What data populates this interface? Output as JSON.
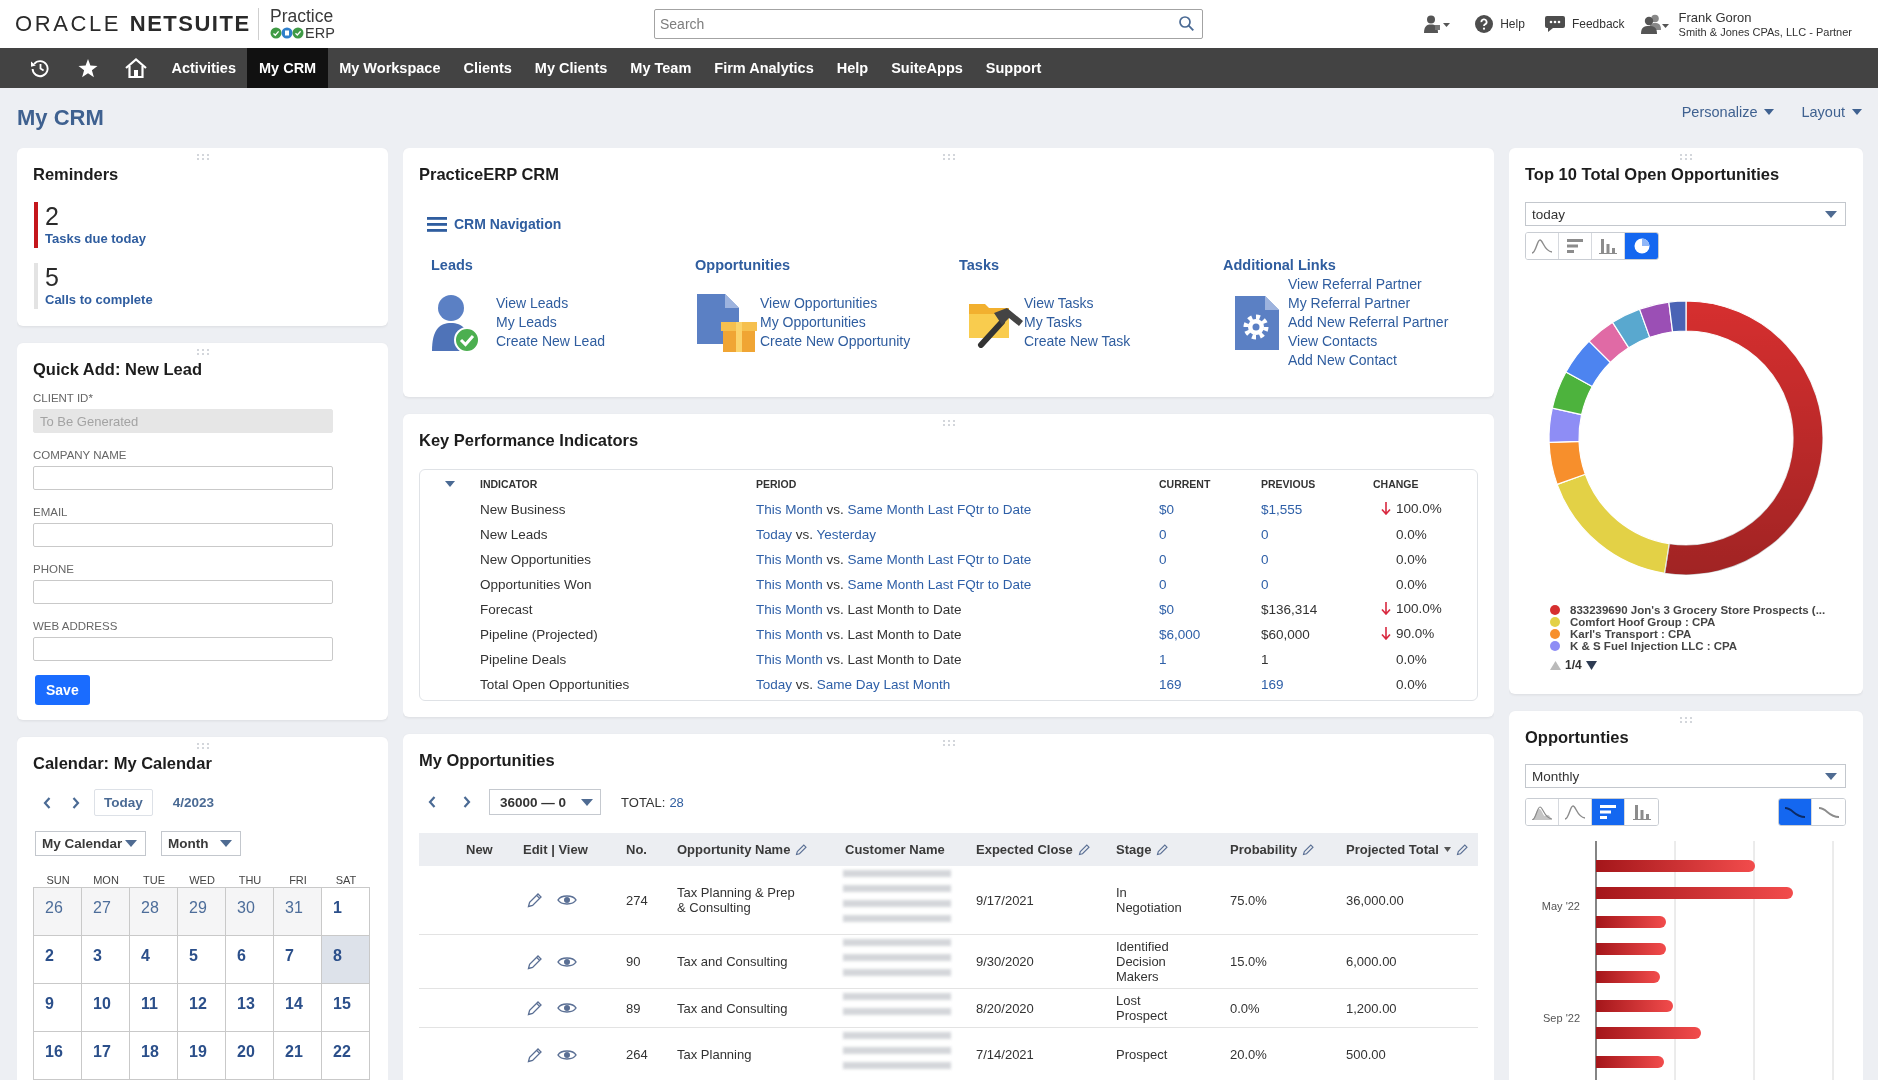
{
  "header": {
    "brand": {
      "primary": "ORACLE",
      "secondary": "NETSUITE"
    },
    "partner_logo": {
      "top": "Practice",
      "bottom": "ERP"
    },
    "search": {
      "placeholder": "Search"
    },
    "links": [
      {
        "label": "Help",
        "kind": "help"
      },
      {
        "label": "Feedback",
        "kind": "feedback"
      }
    ],
    "user": {
      "name": "Frank Goron",
      "role": "Smith & Jones CPAs, LLC - Partner"
    }
  },
  "nav": {
    "items": [
      {
        "label": "Activities",
        "selected": false
      },
      {
        "label": "My CRM",
        "selected": true
      },
      {
        "label": "My Workspace",
        "selected": false
      },
      {
        "label": "Clients",
        "selected": false
      },
      {
        "label": "My Clients",
        "selected": false
      },
      {
        "label": "My Team",
        "selected": false
      },
      {
        "label": "Firm Analytics",
        "selected": false
      },
      {
        "label": "Help",
        "selected": false
      },
      {
        "label": "SuiteApps",
        "selected": false
      },
      {
        "label": "Support",
        "selected": false
      }
    ]
  },
  "page": {
    "title": "My CRM",
    "actions": [
      "Personalize",
      "Layout"
    ]
  },
  "reminders": {
    "title": "Reminders",
    "items": [
      {
        "count": "2",
        "label": "Tasks due today",
        "urgent": true
      },
      {
        "count": "5",
        "label": "Calls to complete",
        "urgent": false
      }
    ]
  },
  "quick_add": {
    "title": "Quick Add: New Lead",
    "fields": [
      {
        "label": "CLIENT ID*",
        "value": "To Be Generated",
        "disabled": true
      },
      {
        "label": "COMPANY NAME",
        "disabled": false
      },
      {
        "label": "EMAIL",
        "disabled": false
      },
      {
        "label": "PHONE",
        "disabled": false
      },
      {
        "label": "WEB ADDRESS",
        "disabled": false
      }
    ],
    "button": "Save"
  },
  "calendar": {
    "title": "Calendar: My Calendar",
    "today_button": "Today",
    "period": "4/2023",
    "selects": [
      "My Calendar",
      "Month"
    ],
    "weekdays": [
      "SUN",
      "MON",
      "TUE",
      "WED",
      "THU",
      "FRI",
      "SAT"
    ],
    "weeks": [
      [
        {
          "day": "26",
          "in_month": false,
          "today": false
        },
        {
          "day": "27",
          "in_month": false,
          "today": false
        },
        {
          "day": "28",
          "in_month": false,
          "today": false
        },
        {
          "day": "29",
          "in_month": false,
          "today": false
        },
        {
          "day": "30",
          "in_month": false,
          "today": false
        },
        {
          "day": "31",
          "in_month": false,
          "today": false
        },
        {
          "day": "1",
          "in_month": true,
          "today": false
        }
      ],
      [
        {
          "day": "2",
          "in_month": true,
          "today": false
        },
        {
          "day": "3",
          "in_month": true,
          "today": false
        },
        {
          "day": "4",
          "in_month": true,
          "today": false
        },
        {
          "day": "5",
          "in_month": true,
          "today": false
        },
        {
          "day": "6",
          "in_month": true,
          "today": false
        },
        {
          "day": "7",
          "in_month": true,
          "today": false
        },
        {
          "day": "8",
          "in_month": true,
          "today": true
        }
      ],
      [
        {
          "day": "9",
          "in_month": true,
          "today": false
        },
        {
          "day": "10",
          "in_month": true,
          "today": false
        },
        {
          "day": "11",
          "in_month": true,
          "today": false
        },
        {
          "day": "12",
          "in_month": true,
          "today": false
        },
        {
          "day": "13",
          "in_month": true,
          "today": false
        },
        {
          "day": "14",
          "in_month": true,
          "today": false
        },
        {
          "day": "15",
          "in_month": true,
          "today": false
        }
      ],
      [
        {
          "day": "16",
          "in_month": true,
          "today": false
        },
        {
          "day": "17",
          "in_month": true,
          "today": false
        },
        {
          "day": "18",
          "in_month": true,
          "today": false
        },
        {
          "day": "19",
          "in_month": true,
          "today": false
        },
        {
          "day": "20",
          "in_month": true,
          "today": false
        },
        {
          "day": "21",
          "in_month": true,
          "today": false
        },
        {
          "day": "22",
          "in_month": true,
          "today": false
        }
      ]
    ]
  },
  "crm": {
    "title": "PracticeERP CRM",
    "nav_link": "CRM Navigation",
    "sections": [
      {
        "kind": "leads",
        "title": "Leads",
        "links": [
          "View Leads",
          "My Leads",
          "Create New Lead"
        ]
      },
      {
        "kind": "opportunities",
        "title": "Opportunities",
        "links": [
          "View Opportunities",
          "My Opportunities",
          "Create New Opportunity"
        ]
      },
      {
        "kind": "tasks",
        "title": "Tasks",
        "links": [
          "View Tasks",
          "My Tasks",
          "Create New Task"
        ]
      },
      {
        "kind": "additional",
        "title": "Additional Links",
        "links": [
          "View Referral Partner",
          "My Referral Partner",
          "Add New Referral Partner",
          "View Contacts",
          "Add New Contact"
        ]
      }
    ]
  },
  "kpi": {
    "title": "Key Performance Indicators",
    "expanded": true,
    "columns": [
      "INDICATOR",
      "PERIOD",
      "CURRENT",
      "PREVIOUS",
      "CHANGE"
    ],
    "rows": [
      {
        "indicator": "New Business",
        "period": {
          "current": "This Month",
          "vs": "vs.",
          "compare": "Same Month Last FQtr to Date",
          "compare_link": true
        },
        "current": {
          "text": "$0",
          "link": true
        },
        "previous": {
          "text": "$1,555",
          "link": true
        },
        "change": {
          "text": "100.0%",
          "down": true
        }
      },
      {
        "indicator": "New Leads",
        "period": {
          "current": "Today",
          "vs": "vs.",
          "compare": "Yesterday",
          "compare_link": true
        },
        "current": {
          "text": "0",
          "link": true
        },
        "previous": {
          "text": "0",
          "link": true
        },
        "change": {
          "text": "0.0%",
          "down": false
        }
      },
      {
        "indicator": "New Opportunities",
        "period": {
          "current": "This Month",
          "vs": "vs.",
          "compare": "Same Month Last FQtr to Date",
          "compare_link": true
        },
        "current": {
          "text": "0",
          "link": true
        },
        "previous": {
          "text": "0",
          "link": true
        },
        "change": {
          "text": "0.0%",
          "down": false
        }
      },
      {
        "indicator": "Opportunities Won",
        "period": {
          "current": "This Month",
          "vs": "vs.",
          "compare": "Same Month Last FQtr to Date",
          "compare_link": true
        },
        "current": {
          "text": "0",
          "link": true
        },
        "previous": {
          "text": "0",
          "link": true
        },
        "change": {
          "text": "0.0%",
          "down": false
        }
      },
      {
        "indicator": "Forecast",
        "period": {
          "current": "This Month",
          "vs": "vs.",
          "compare": "Last Month to Date",
          "compare_link": false
        },
        "current": {
          "text": "$0",
          "link": true
        },
        "previous": {
          "text": "$136,314",
          "link": false
        },
        "change": {
          "text": "100.0%",
          "down": true
        }
      },
      {
        "indicator": "Pipeline (Projected)",
        "period": {
          "current": "This Month",
          "vs": "vs.",
          "compare": "Last Month to Date",
          "compare_link": false
        },
        "current": {
          "text": "$6,000",
          "link": true
        },
        "previous": {
          "text": "$60,000",
          "link": false
        },
        "change": {
          "text": "90.0%",
          "down": true
        }
      },
      {
        "indicator": "Pipeline Deals",
        "period": {
          "current": "This Month",
          "vs": "vs.",
          "compare": "Last Month to Date",
          "compare_link": false
        },
        "current": {
          "text": "1",
          "link": true
        },
        "previous": {
          "text": "1",
          "link": false
        },
        "change": {
          "text": "0.0%",
          "down": false
        }
      },
      {
        "indicator": "Total Open Opportunities",
        "period": {
          "current": "Today",
          "vs": "vs.",
          "compare": "Same Day Last Month",
          "compare_link": true
        },
        "current": {
          "text": "169",
          "link": true
        },
        "previous": {
          "text": "169",
          "link": true
        },
        "change": {
          "text": "0.0%",
          "down": false
        }
      }
    ]
  },
  "opportunities": {
    "title": "My Opportunities",
    "range": "36000 — 0",
    "total_label": "TOTAL:",
    "total": "28",
    "columns": [
      {
        "label": "New",
        "editable": false,
        "sorted": false
      },
      {
        "label": "Edit | View",
        "editable": false,
        "sorted": false
      },
      {
        "label": "No.",
        "editable": false,
        "sorted": false
      },
      {
        "label": "Opportunity Name",
        "editable": true,
        "sorted": false
      },
      {
        "label": "Customer Name",
        "editable": false,
        "sorted": false
      },
      {
        "label": "Expected Close",
        "editable": true,
        "sorted": false
      },
      {
        "label": "Stage",
        "editable": true,
        "sorted": false
      },
      {
        "label": "Probability",
        "editable": true,
        "sorted": false
      },
      {
        "label": "Projected Total",
        "editable": true,
        "sorted": true
      }
    ],
    "rows": [
      {
        "number": "274",
        "name": "Tax Planning & Prep & Consulting",
        "expected_close": "9/17/2021",
        "stage": "In Negotiation",
        "probability": "75.0%",
        "projected_total": "36,000.00"
      },
      {
        "number": "90",
        "name": "Tax and Consulting",
        "expected_close": "9/30/2020",
        "stage": "Identified Decision Makers",
        "probability": "15.0%",
        "projected_total": "6,000.00"
      },
      {
        "number": "89",
        "name": "Tax and Consulting",
        "expected_close": "8/20/2020",
        "stage": "Lost Prospect",
        "probability": "0.0%",
        "projected_total": "1,200.00"
      },
      {
        "number": "264",
        "name": "Tax Planning",
        "expected_close": "7/14/2021",
        "stage": "Prospect",
        "probability": "20.0%",
        "projected_total": "500.00"
      }
    ]
  },
  "top10": {
    "title": "Top 10 Total Open Opportunities",
    "period": "today",
    "chart_types": [
      {
        "kind": "line",
        "selected": false
      },
      {
        "kind": "hbar",
        "selected": false
      },
      {
        "kind": "vbar",
        "selected": false
      },
      {
        "kind": "pie",
        "selected": true
      }
    ],
    "legend": [
      {
        "label": "833239690 Jon's 3 Grocery Store Prospects (...",
        "color": "#d62f2f"
      },
      {
        "label": "Comfort Hoof Group : CPA",
        "color": "#e3d146"
      },
      {
        "label": "Karl's Transport : CPA",
        "color": "#f78f2c"
      },
      {
        "label": "K & S Fuel Injection LLC : CPA",
        "color": "#8e8df5"
      }
    ],
    "pager": {
      "label": "1/4",
      "previous_enabled": false,
      "next_enabled": true
    }
  },
  "opps_chart": {
    "title": "Opportunties",
    "period": "Monthly",
    "chart_types": [
      {
        "kind": "area",
        "selected": false
      },
      {
        "kind": "line",
        "selected": false
      },
      {
        "kind": "hbar",
        "selected": true
      },
      {
        "kind": "vbar",
        "selected": false
      }
    ],
    "curve_modes": [
      {
        "selected": true
      },
      {
        "selected": false
      }
    ],
    "y_labels": [
      "May '22",
      "Sep '22"
    ]
  }
}
